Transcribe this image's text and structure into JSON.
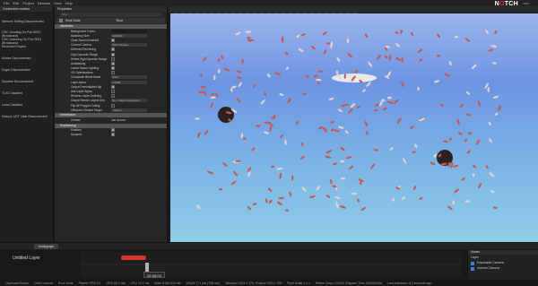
{
  "menu": [
    "File",
    "Edit",
    "Project",
    "Devices",
    "View",
    "Help"
  ],
  "logo": {
    "text_a": "N",
    "text_o": "O",
    "text_b": "TCH",
    "sub": "PRO"
  },
  "connection": {
    "tab": "Connection monitor",
    "items": [
      "Network Editing Disconnected",
      "OSC Sending On Port 8000 (Broadcast)",
      "OSC Listening On Port 9001 (Broadcast)",
      "Received 0 bytes",
      "Motive Disconnected",
      "Sugar Disconnected",
      "Skyview Disconnected",
      "TUIO Disabled",
      "Leica Disabled",
      "Hokuyo UST Lidar Disconnected"
    ]
  },
  "properties": {
    "tab": "Properties",
    "search_placeholder": "Filter",
    "root_node": {
      "label": "Root Node",
      "value": "Root"
    },
    "attributes_section": "Attributes",
    "rows": [
      {
        "label": "Background Colour",
        "value": "",
        "type": "color"
      },
      {
        "label": "Backdrop Size",
        "value": "1000000",
        "type": "field"
      },
      {
        "label": "Clear Screen Enabled",
        "type": "check",
        "on": true
      },
      {
        "label": "Current Camera",
        "value": "Orbit Camera",
        "type": "field"
      },
      {
        "label": "Deferred Rendering",
        "type": "check",
        "on": true
      },
      {
        "label": "High Dynamic Range",
        "type": "check",
        "on": true
      },
      {
        "label": "Refine High Dynamic Range",
        "type": "check",
        "on": false
      },
      {
        "label": "Antialiasing",
        "type": "check",
        "on": true
      },
      {
        "label": "Linear Space Lighting",
        "type": "check",
        "on": true
      },
      {
        "label": "VR Optimisations",
        "type": "check",
        "on": false
      },
      {
        "label": "Composite Blend Mode",
        "value": "Solid",
        "type": "field"
      },
      {
        "label": "Layer Alpha",
        "value": "1.0000",
        "type": "field"
      },
      {
        "label": "Output Premultiplied Alp",
        "type": "check",
        "on": true
      },
      {
        "label": "Use Layer Alpha",
        "type": "check",
        "on": false
      },
      {
        "label": "Reverse Layer Ordering",
        "type": "check",
        "on": false
      },
      {
        "label": "Output Render Layers Sep",
        "value": "No - Output Composite",
        "type": "field"
      },
      {
        "label": "Flip All Polygon Culling",
        "type": "check",
        "on": false
      },
      {
        "label": "Offscreen Render Target",
        "value": "<None>",
        "type": "field"
      }
    ],
    "information_section": "Information",
    "creator_label": "Creator",
    "creator_value": "Jan Izcorra",
    "keyframing_section": "Keyframing",
    "enabled_label": "Enabled",
    "dynamic_label": "Dynamic"
  },
  "timeline": {
    "tab_label": "Nodegraph",
    "layer_name": "Untitled Layer",
    "timecode": "02:06:03",
    "track_label": "Untitled Layer"
  },
  "nodes_panel": {
    "header": "Nodes",
    "layer_label": "Layer",
    "items": [
      "Exposable Camera",
      "Volume Camera"
    ]
  },
  "status": [
    "Clipboard Empty",
    "Orbit Camera",
    "Root Node",
    "Parent: FPS 0.1",
    "GPU 60.1 ms",
    "CPU 70.2 ms",
    "Main RAM 404 mb",
    "VRAM 771 mb (798 mb)",
    "Viewport 1201 x 720, Project 1920 x 720",
    "Pixel Scale 1 x 1",
    "Refine Steps 1/1000, Elapsed Time 00h00m03s",
    "Last Autosave 113 seconds ago"
  ],
  "colors": {
    "accent": "#e03030",
    "sky_top": "#6d94e3",
    "sky_bottom": "#8fcde8",
    "fish": "#c45a55"
  }
}
